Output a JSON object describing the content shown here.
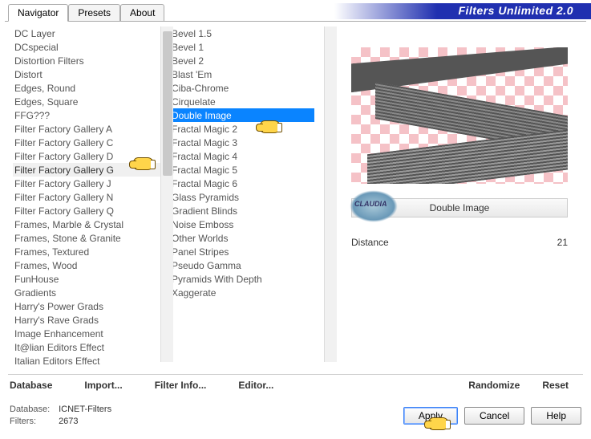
{
  "header": {
    "title": "Filters Unlimited 2.0"
  },
  "tabs": [
    "Navigator",
    "Presets",
    "About"
  ],
  "active_tab": 0,
  "categories": [
    "DC Layer",
    "DCspecial",
    "Distortion Filters",
    "Distort",
    "Edges, Round",
    "Edges, Square",
    "FFG???",
    "Filter Factory Gallery A",
    "Filter Factory Gallery C",
    "Filter Factory Gallery D",
    "Filter Factory Gallery G",
    "Filter Factory Gallery J",
    "Filter Factory Gallery N",
    "Filter Factory Gallery Q",
    "Frames, Marble & Crystal",
    "Frames, Stone & Granite",
    "Frames, Textured",
    "Frames, Wood",
    "FunHouse",
    "Gradients",
    "Harry's Power Grads",
    "Harry's Rave Grads",
    "Image Enhancement",
    "It@lian Editors Effect",
    "Italian Editors Effect"
  ],
  "selected_category_index": 10,
  "filters": [
    "Bevel 1.5",
    "Bevel 1",
    "Bevel 2",
    "Blast 'Em",
    "Ciba-Chrome",
    "Cirquelate",
    "Double Image",
    "Fractal Magic 2",
    "Fractal Magic 3",
    "Fractal Magic 4",
    "Fractal Magic 5",
    "Fractal Magic 6",
    "Glass Pyramids",
    "Gradient Blinds",
    "Noise Emboss",
    "Other Worlds",
    "Panel Stripes",
    "Pseudo Gamma",
    "Pyramids With Depth",
    "Xaggerate"
  ],
  "selected_filter_index": 6,
  "current_filter_label": "Double Image",
  "param": {
    "name": "Distance",
    "value": "21"
  },
  "mid_buttons": {
    "database": "Database",
    "import": "Import...",
    "filter_info": "Filter Info...",
    "editor": "Editor..."
  },
  "right_mid": {
    "randomize": "Randomize",
    "reset": "Reset"
  },
  "status": {
    "db_label": "Database:",
    "db_value": "ICNET-Filters",
    "filters_label": "Filters:",
    "filters_value": "2673"
  },
  "buttons": {
    "apply": "Apply",
    "cancel": "Cancel",
    "help": "Help"
  }
}
